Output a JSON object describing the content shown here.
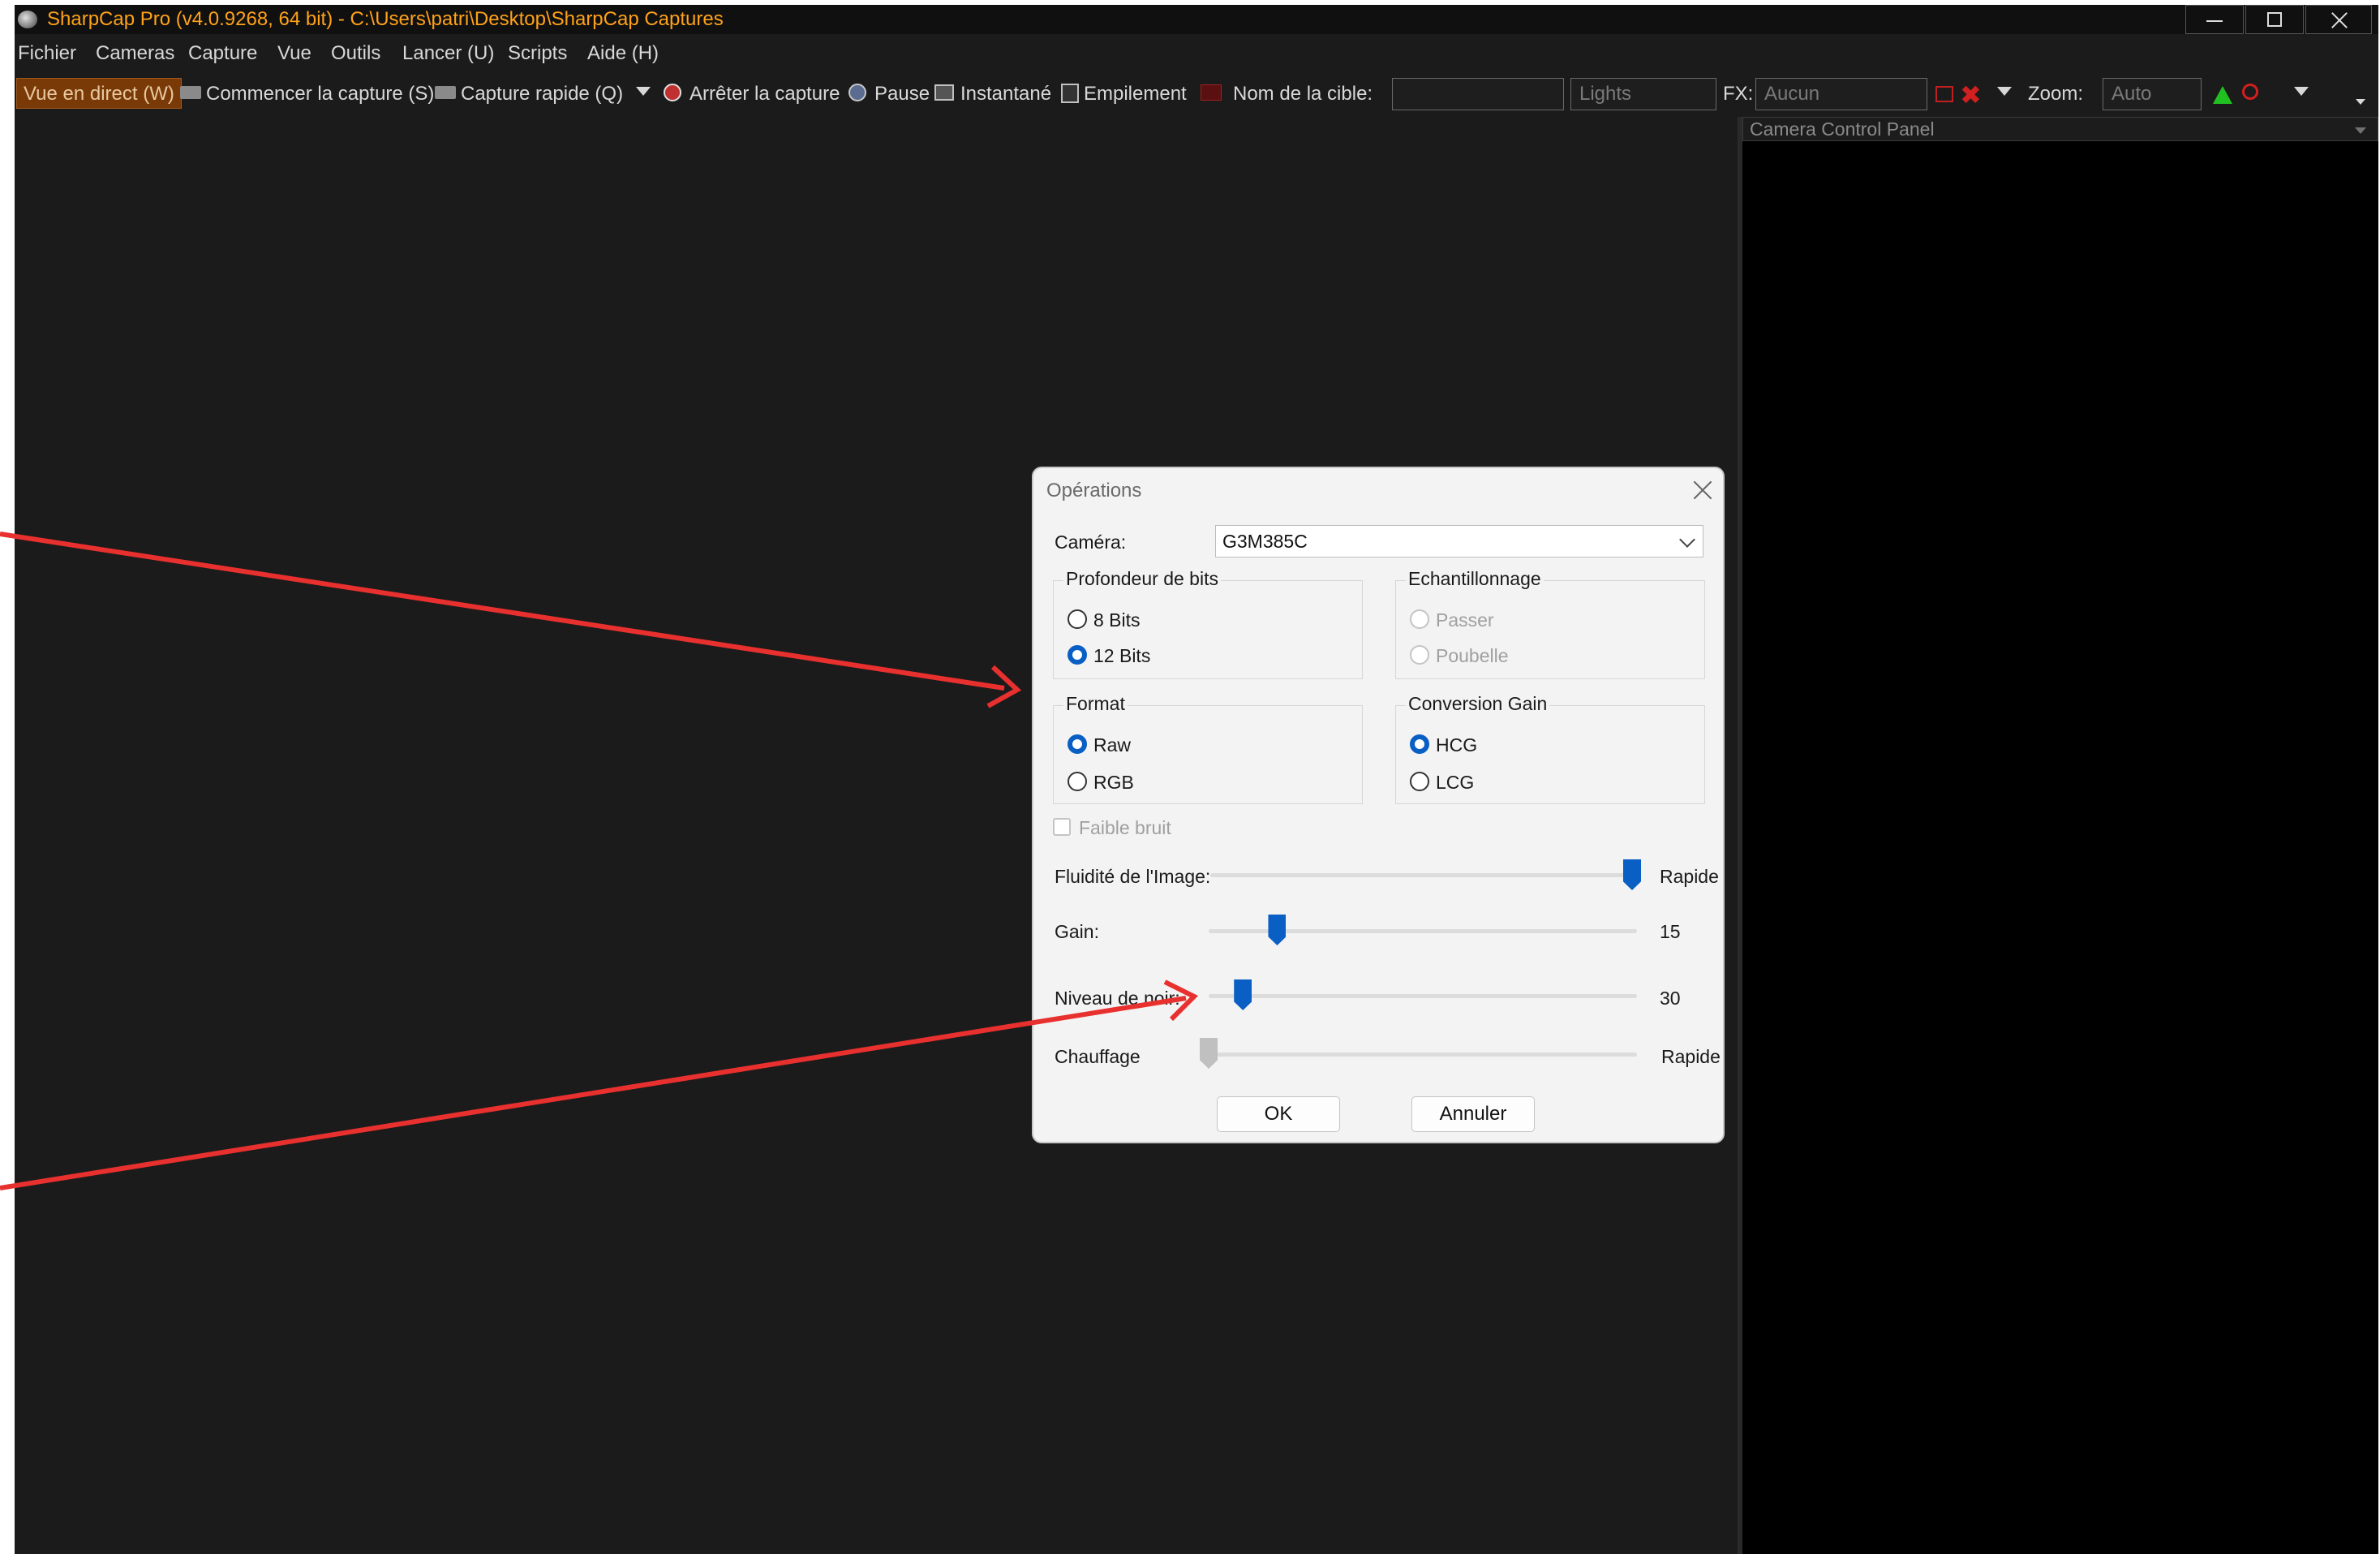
{
  "window": {
    "title": "SharpCap Pro (v4.0.9268, 64 bit) - C:\\Users\\patri\\Desktop\\SharpCap Captures"
  },
  "menu": [
    "Fichier",
    "Cameras",
    "Capture",
    "Vue",
    "Outils",
    "Lancer (U)",
    "Scripts",
    "Aide (H)"
  ],
  "toolbar": {
    "live_view": "Vue en direct (W)",
    "start_capture": "Commencer la capture (S)",
    "quick_capture": "Capture rapide (Q)",
    "stop_capture": "Arrêter la capture",
    "pause": "Pause",
    "snapshot": "Instantané",
    "stacking": "Empilement",
    "target_label": "Nom de la cible:",
    "target_value": "",
    "frame_type": "Lights",
    "fx_label": "FX:",
    "fx_value": "Aucun",
    "zoom_label": "Zoom:",
    "zoom_value": "Auto"
  },
  "camera_panel": {
    "title": "Camera Control Panel"
  },
  "dialog": {
    "title": "Opérations",
    "camera_label": "Caméra:",
    "camera_value": "G3M385C",
    "bit_depth": {
      "label": "Profondeur de bits",
      "options": [
        "8 Bits",
        "12 Bits"
      ],
      "selected": "12 Bits"
    },
    "binning": {
      "label": "Echantillonnage",
      "options": [
        "Passer",
        "Poubelle"
      ],
      "enabled": false
    },
    "format": {
      "label": "Format",
      "options": [
        "Raw",
        "RGB"
      ],
      "selected": "Raw"
    },
    "conversion_gain": {
      "label": "Conversion Gain",
      "options": [
        "HCG",
        "LCG"
      ],
      "selected": "HCG"
    },
    "low_noise": {
      "label": "Faible bruit",
      "checked": false,
      "enabled": false
    },
    "fluidity": {
      "label": "Fluidité de l'Image:",
      "value": "Rapide",
      "position": 1.0
    },
    "gain": {
      "label": "Gain:",
      "value": "15",
      "position": 0.16
    },
    "black_level": {
      "label": "Niveau de noir:",
      "value": "30",
      "position": 0.08
    },
    "heating": {
      "label": "Chauffage",
      "value": "Rapide",
      "position": 0.0,
      "enabled": false
    },
    "ok_label": "OK",
    "cancel_label": "Annuler"
  },
  "annotation": {
    "arrow_color": "#e8302e"
  }
}
